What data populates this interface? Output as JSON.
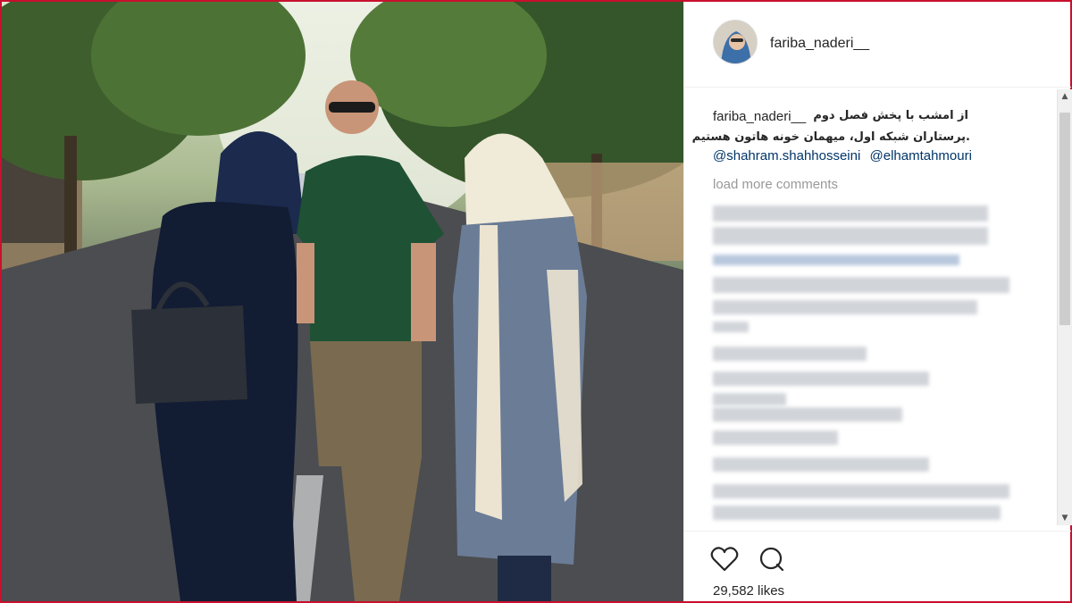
{
  "post": {
    "username": "fariba_naderi__",
    "caption": {
      "username": "fariba_naderi__",
      "line1": "از امشب با پخش فصل دوم",
      "line2": ".پرستاران شبکه اول، میهمان خونه هاتون هستیم",
      "mentions": [
        "@shahram.shahhosseini",
        "@elhamtahmouri"
      ]
    },
    "load_more": "load more comments",
    "likes": "29,582 likes"
  },
  "icons": {
    "like": "heart-outline-icon",
    "comment": "speech-bubble-icon",
    "scroll_up": "triangle-up-icon",
    "scroll_down": "triangle-down-icon"
  },
  "colors": {
    "frame": "#c8102e",
    "mention": "#003569",
    "muted": "#999999"
  }
}
